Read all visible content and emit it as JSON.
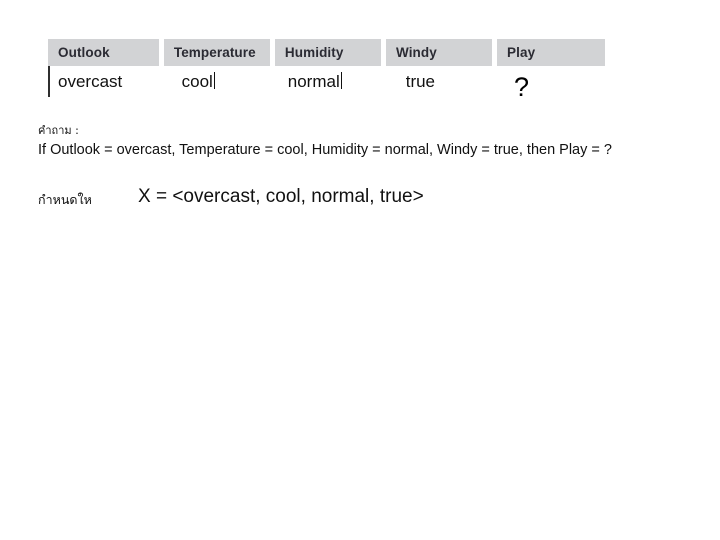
{
  "slide": {
    "table": {
      "headers": [
        "Outlook",
        "Temperature",
        "Humidity",
        "Windy",
        "Play"
      ],
      "row": [
        "overcast",
        "cool",
        "normal",
        "true",
        "?"
      ]
    },
    "question_label": "คำถาม  :",
    "question_sentence": "If Outlook = overcast, Temperature = cool, Humidity = normal, Windy = true, then Play = ?",
    "given_label": "กำหนดให",
    "assignment": "X = <overcast, cool, normal, true>",
    "colors": {
      "header_fill": "#d2d3d5",
      "header_text": "#2b2b33",
      "body_text": "#111111",
      "rule": "#2f2f2f",
      "background": "#ffffff"
    }
  }
}
